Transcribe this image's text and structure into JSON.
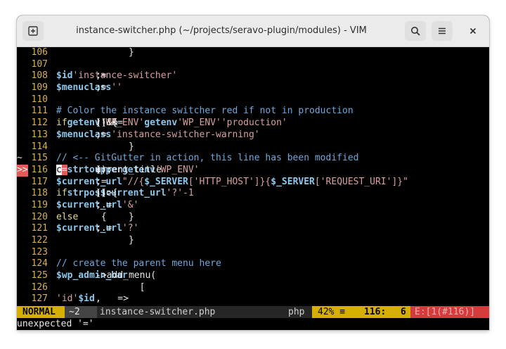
{
  "window": {
    "title": "instance-switcher.php (~/projects/seravo-plugin/modules) - VIM"
  },
  "lines": [
    {
      "num": "106",
      "sign": "",
      "segs": [
        {
          "c": "code",
          "t": "      }"
        }
      ]
    },
    {
      "num": "107",
      "sign": "",
      "segs": []
    },
    {
      "num": "108",
      "sign": "",
      "segs": [
        {
          "c": "code",
          "t": "      "
        },
        {
          "c": "var",
          "t": "$id"
        },
        {
          "c": "code",
          "t": " = "
        },
        {
          "c": "str",
          "t": "'instance-switcher'"
        },
        {
          "c": "code",
          "t": ";"
        }
      ]
    },
    {
      "num": "109",
      "sign": "",
      "segs": [
        {
          "c": "code",
          "t": "      "
        },
        {
          "c": "var",
          "t": "$menuclass"
        },
        {
          "c": "code",
          "t": " = "
        },
        {
          "c": "str",
          "t": "''"
        },
        {
          "c": "code",
          "t": ";"
        }
      ]
    },
    {
      "num": "110",
      "sign": "",
      "segs": []
    },
    {
      "num": "111",
      "sign": "",
      "segs": [
        {
          "c": "code",
          "t": "      "
        },
        {
          "c": "cm",
          "t": "# Color the instance switcher red if not in production"
        }
      ]
    },
    {
      "num": "112",
      "sign": "",
      "segs": [
        {
          "c": "code",
          "t": "      "
        },
        {
          "c": "kw",
          "t": "if"
        },
        {
          "c": "code",
          "t": " ( "
        },
        {
          "c": "fn",
          "t": "getenv"
        },
        {
          "c": "code",
          "t": "("
        },
        {
          "c": "str",
          "t": "'WP_ENV'"
        },
        {
          "c": "code",
          "t": ") && "
        },
        {
          "c": "fn",
          "t": "getenv"
        },
        {
          "c": "code",
          "t": "("
        },
        {
          "c": "str",
          "t": "'WP_ENV'"
        },
        {
          "c": "code",
          "t": ") !== "
        },
        {
          "c": "str",
          "t": "'production'"
        },
        {
          "c": "code",
          "t": " ) {"
        }
      ]
    },
    {
      "num": "113",
      "sign": "",
      "segs": [
        {
          "c": "code",
          "t": "        "
        },
        {
          "c": "var",
          "t": "$menuclass"
        },
        {
          "c": "code",
          "t": " = "
        },
        {
          "c": "str",
          "t": "'instance-switcher-warning'"
        },
        {
          "c": "code",
          "t": ";"
        }
      ]
    },
    {
      "num": "114",
      "sign": "",
      "segs": [
        {
          "c": "code",
          "t": "      }"
        }
      ]
    },
    {
      "num": "115",
      "sign": "~",
      "segs": [
        {
          "c": "code",
          "t": "      "
        },
        {
          "c": "cm",
          "t": "// <-- GitGutter in action, this line has been modified"
        }
      ]
    },
    {
      "num": "116",
      "sign": ">>",
      "segs": [
        {
          "c": "code",
          "t": "      "
        },
        {
          "c": "cursor",
          "t": "c"
        },
        {
          "c": "code",
          "t": "urrent_title "
        },
        {
          "c": "errmark",
          "t": "="
        },
        {
          "c": "code",
          "t": " "
        },
        {
          "c": "fn",
          "t": "strtoupper"
        },
        {
          "c": "code",
          "t": "("
        },
        {
          "c": "fn",
          "t": "getenv"
        },
        {
          "c": "code",
          "t": "("
        },
        {
          "c": "str",
          "t": "'WP_ENV'"
        },
        {
          "c": "code",
          "t": "));"
        }
      ]
    },
    {
      "num": "117",
      "sign": "",
      "segs": [
        {
          "c": "code",
          "t": "      "
        },
        {
          "c": "var",
          "t": "$current_url"
        },
        {
          "c": "code",
          "t": " = "
        },
        {
          "c": "str",
          "t": "\"//{"
        },
        {
          "c": "var",
          "t": "$_SERVER"
        },
        {
          "c": "str",
          "t": "['HTTP_HOST']}{"
        },
        {
          "c": "var",
          "t": "$_SERVER"
        },
        {
          "c": "str",
          "t": "['REQUEST_URI']}\""
        },
        {
          "c": "code",
          "t": ";"
        }
      ]
    },
    {
      "num": "118",
      "sign": "",
      "segs": [
        {
          "c": "code",
          "t": "      "
        },
        {
          "c": "kw",
          "t": "if"
        },
        {
          "c": "code",
          "t": " ( "
        },
        {
          "c": "fn",
          "t": "strpos"
        },
        {
          "c": "code",
          "t": "("
        },
        {
          "c": "var",
          "t": "$current_url"
        },
        {
          "c": "code",
          "t": ", "
        },
        {
          "c": "str",
          "t": "'?'"
        },
        {
          "c": "code",
          "t": ") > "
        },
        {
          "c": "str",
          "t": "-1"
        },
        {
          "c": "code",
          "t": " ) {"
        }
      ]
    },
    {
      "num": "119",
      "sign": "",
      "segs": [
        {
          "c": "code",
          "t": "        "
        },
        {
          "c": "var",
          "t": "$current_url"
        },
        {
          "c": "code",
          "t": " .= "
        },
        {
          "c": "str",
          "t": "'&'"
        },
        {
          "c": "code",
          "t": ";"
        }
      ]
    },
    {
      "num": "120",
      "sign": "",
      "segs": [
        {
          "c": "code",
          "t": "      } "
        },
        {
          "c": "kw",
          "t": "else"
        },
        {
          "c": "code",
          "t": " {"
        }
      ]
    },
    {
      "num": "121",
      "sign": "",
      "segs": [
        {
          "c": "code",
          "t": "        "
        },
        {
          "c": "var",
          "t": "$current_url"
        },
        {
          "c": "code",
          "t": " .= "
        },
        {
          "c": "str",
          "t": "'?'"
        },
        {
          "c": "code",
          "t": ";"
        }
      ]
    },
    {
      "num": "122",
      "sign": "",
      "segs": [
        {
          "c": "code",
          "t": "      }"
        }
      ]
    },
    {
      "num": "123",
      "sign": "",
      "segs": []
    },
    {
      "num": "124",
      "sign": "",
      "segs": [
        {
          "c": "code",
          "t": "      "
        },
        {
          "c": "cm",
          "t": "// create the parent menu here"
        }
      ]
    },
    {
      "num": "125",
      "sign": "",
      "segs": [
        {
          "c": "code",
          "t": "      "
        },
        {
          "c": "var",
          "t": "$wp_admin_bar"
        },
        {
          "c": "code",
          "t": "->add_menu("
        }
      ]
    },
    {
      "num": "126",
      "sign": "",
      "segs": [
        {
          "c": "code",
          "t": "        ["
        }
      ]
    },
    {
      "num": "127",
      "sign": "",
      "segs": [
        {
          "c": "code",
          "t": "          "
        },
        {
          "c": "str",
          "t": "'id'"
        },
        {
          "c": "code",
          "t": "    => "
        },
        {
          "c": "var",
          "t": "$id"
        },
        {
          "c": "code",
          "t": ","
        }
      ]
    }
  ],
  "status": {
    "mode": "NORMAL",
    "hunks": "~2",
    "filename": "instance-switcher.php",
    "filetype": "php",
    "percent": "42% ≡",
    "line": "116:",
    "col": "6",
    "error": "E:[1(#116)]"
  },
  "cmdline": "unexpected '='",
  "colors": {
    "mode_bg": "#d7af00",
    "error_bg": "#d63b3b",
    "percent_bg": "#d7af00"
  }
}
